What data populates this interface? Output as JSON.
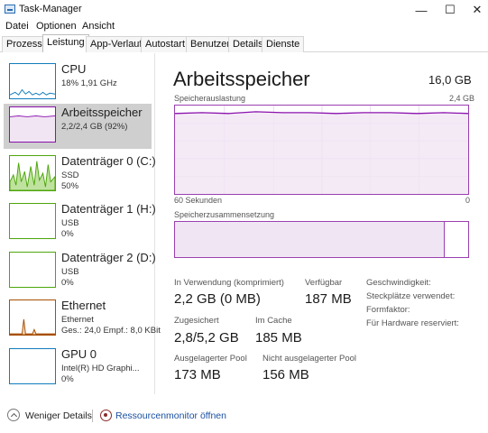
{
  "window": {
    "title": "Task-Manager",
    "minimize_glyph": "—",
    "maximize_glyph": "☐",
    "close_glyph": "✕"
  },
  "menu": [
    "Datei",
    "Optionen",
    "Ansicht"
  ],
  "tabs": [
    {
      "label": "Prozesse",
      "active": false
    },
    {
      "label": "Leistung",
      "active": true
    },
    {
      "label": "App-Verlauf",
      "active": false
    },
    {
      "label": "Autostart",
      "active": false
    },
    {
      "label": "Benutzer",
      "active": false
    },
    {
      "label": "Details",
      "active": false
    },
    {
      "label": "Dienste",
      "active": false
    }
  ],
  "sidebar": {
    "items": [
      {
        "name": "CPU",
        "lines": [
          "18% 1,91 GHz"
        ],
        "color": "#117dbb",
        "selected": false,
        "icon": "cpu-graph-icon"
      },
      {
        "name": "Arbeitsspeicher",
        "lines": [
          "2,2/2,4 GB (92%)"
        ],
        "color": "#8b12ae",
        "selected": true,
        "icon": "memory-graph-icon"
      },
      {
        "name": "Datenträger 0 (C:)",
        "lines": [
          "SSD",
          "50%"
        ],
        "color": "#4da60c",
        "selected": false,
        "icon": "disk-graph-icon"
      },
      {
        "name": "Datenträger 1 (H:)",
        "lines": [
          "USB",
          "0%"
        ],
        "color": "#4da60c",
        "selected": false,
        "icon": "disk-graph-icon"
      },
      {
        "name": "Datenträger 2 (D:)",
        "lines": [
          "USB",
          "0%"
        ],
        "color": "#4da60c",
        "selected": false,
        "icon": "disk-graph-icon"
      },
      {
        "name": "Ethernet",
        "lines": [
          "Ethernet",
          "Ges.: 24,0 Empf.: 8,0 KBit"
        ],
        "color": "#a74f01",
        "selected": false,
        "icon": "network-graph-icon"
      },
      {
        "name": "GPU 0",
        "lines": [
          "Intel(R) HD Graphi...",
          "0%"
        ],
        "color": "#117dbb",
        "selected": false,
        "icon": "gpu-graph-icon"
      }
    ]
  },
  "memory": {
    "title": "Arbeitsspeicher",
    "total": "16,0 GB",
    "usage_label": "Speicherauslastung",
    "usage_max": "2,4 GB",
    "time_label": "60 Sekunden",
    "time_end": "0",
    "composition_label": "Speicherzusammensetzung",
    "usage_fraction": 0.92,
    "stats": {
      "in_use_label": "In Verwendung (komprimiert)",
      "in_use_value": "2,2 GB (0 MB)",
      "available_label": "Verfügbar",
      "available_value": "187 MB",
      "committed_label": "Zugesichert",
      "committed_value": "2,8/5,2 GB",
      "cached_label": "Im Cache",
      "cached_value": "185 MB",
      "paged_label": "Ausgelagerter Pool",
      "paged_value": "173 MB",
      "nonpaged_label": "Nicht ausgelagerter Pool",
      "nonpaged_value": "156 MB"
    },
    "specs": [
      "Geschwindigkeit:",
      "Steckplätze verwendet:",
      "Formfaktor:",
      "Für Hardware reserviert:"
    ]
  },
  "footer": {
    "fewer_details": "Weniger Details",
    "resource_monitor": "Ressourcenmonitor öffnen"
  }
}
